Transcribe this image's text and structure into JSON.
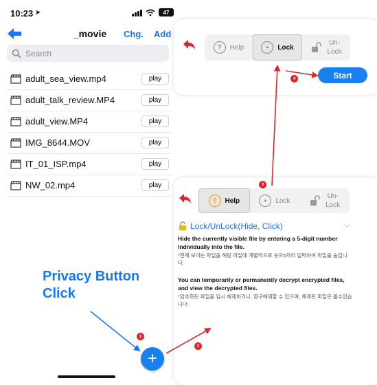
{
  "status_bar": {
    "time": "10:23",
    "battery": "47"
  },
  "nav": {
    "title": "_movie",
    "chg": "Chg.",
    "add": "Add"
  },
  "search": {
    "placeholder": "Search"
  },
  "files": [
    {
      "name": "adult_sea_view.mp4",
      "button": "play"
    },
    {
      "name": "adult_talk_review.MP4",
      "button": "play"
    },
    {
      "name": "adult_view.MP4",
      "button": "play"
    },
    {
      "name": "IMG_8644.MOV",
      "button": "play"
    },
    {
      "name": "IT_01_ISP.mp4",
      "button": "play"
    },
    {
      "name": "NW_02.mp4",
      "button": "play"
    }
  ],
  "annotation": {
    "line1": "Privacy Button",
    "line2": "Click"
  },
  "fab": {
    "label": "+"
  },
  "steps": [
    "1",
    "2",
    "3",
    "4"
  ],
  "top_panel": {
    "help": "Help",
    "lock": "Lock",
    "unlock_line1": "Un-",
    "unlock_line2": "Lock",
    "start": "Start",
    "selected": "Lock"
  },
  "bottom_panel": {
    "help": "Help",
    "lock": "Lock",
    "unlock_line1": "Un-",
    "unlock_line2": "Lock",
    "selected": "Help"
  },
  "info": {
    "title": "Lock/UnLock(Hide, Click)",
    "p1": "Hide the currently visible file by entering a 5-digit number individually into the file.",
    "p1_kr": "*현재 보이는 파일을 해당 파일에 개별적으로 숫자5자리 입력하여 파일을 숨깁니다.",
    "p2": "You can temporarily or permanently decrypt encrypted files, and view the decrypted files.",
    "p2_kr": "*암호화된 파일을 임시 해제하거나, 영구해제할 수 있으며, 해제된 파일은 볼수있습니다."
  },
  "colors": {
    "accent": "#1877f2",
    "annotation_red": "#e0242c",
    "help_orange": "#f39b16"
  }
}
